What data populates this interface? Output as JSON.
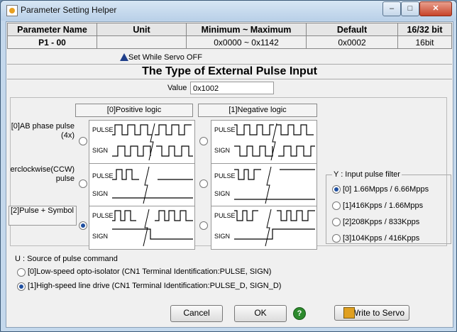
{
  "window": {
    "title": "Parameter Setting Helper",
    "min_glyph": "–",
    "max_glyph": "□",
    "close_glyph": "✕"
  },
  "header": {
    "columns": [
      "Parameter Name",
      "Unit",
      "Minimum ~ Maximum",
      "Default",
      "16/32 bit"
    ],
    "values": [
      "P1 - 00",
      "",
      "0x0000 ~ 0x1142",
      "0x0002",
      "16bit"
    ]
  },
  "servo_note": "Set While Servo OFF",
  "main_title": "The Type of External Pulse Input",
  "value": {
    "label": "Value",
    "text": "0x1002"
  },
  "logic": {
    "positive": "[0]Positive logic",
    "negative": "[1]Negative logic"
  },
  "rows": [
    {
      "label": "[0]AB phase pulse (4x)"
    },
    {
      "label": "erclockwise(CCW) pulse"
    },
    {
      "label": "[2]Pulse + Symbol"
    }
  ],
  "wave_labels": {
    "pulse": "PULSE",
    "sign": "SIGN"
  },
  "filter": {
    "title": "Y : Input pulse filter",
    "options": [
      "[0] 1.66Mpps / 6.66Mpps",
      "[1]416Kpps / 1.66Mpps",
      "[2]208Kpps / 833Kpps",
      "[3]104Kpps / 416Kpps"
    ],
    "selected": 0
  },
  "source": {
    "title": "U : Source of pulse command",
    "options": [
      "[0]Low-speed opto-isolator (CN1 Terminal Identification:PULSE, SIGN)",
      "[1]High-speed line drive (CN1 Terminal Identification:PULSE_D, SIGN_D)"
    ],
    "selected": 1
  },
  "buttons": {
    "cancel": "Cancel",
    "ok": "OK",
    "help": "?",
    "write": "Write to Servo"
  }
}
